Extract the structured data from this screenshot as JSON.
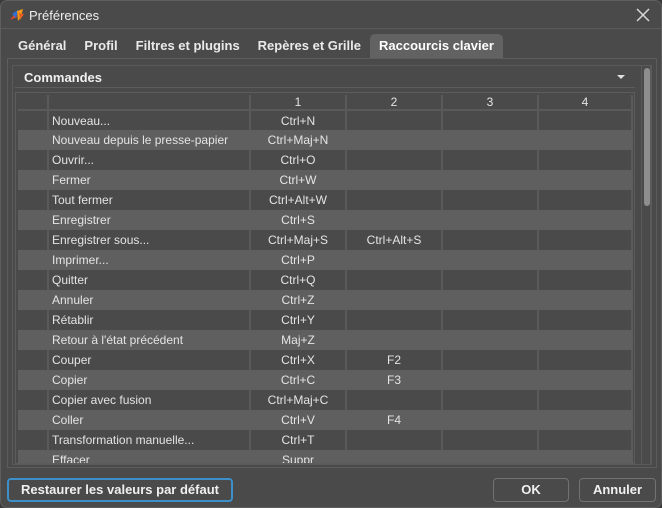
{
  "window": {
    "title": "Préférences",
    "app_icon": "app-logo-icon",
    "close_icon": "close-icon"
  },
  "tabs": [
    {
      "label": "Général",
      "active": false
    },
    {
      "label": "Profil",
      "active": false
    },
    {
      "label": "Filtres et plugins",
      "active": false
    },
    {
      "label": "Repères et Grille",
      "active": false
    },
    {
      "label": "Raccourcis clavier",
      "active": true
    }
  ],
  "section": {
    "title": "Commandes",
    "dropdown_icon": "dropdown-arrow-icon"
  },
  "table": {
    "columns": [
      "",
      "",
      "1",
      "2",
      "3",
      "4"
    ],
    "rows": [
      {
        "command": "Nouveau...",
        "k1": "Ctrl+N",
        "k2": "",
        "k3": "",
        "k4": ""
      },
      {
        "command": "Nouveau depuis le presse-papier",
        "k1": "Ctrl+Maj+N",
        "k2": "",
        "k3": "",
        "k4": ""
      },
      {
        "command": "Ouvrir...",
        "k1": "Ctrl+O",
        "k2": "",
        "k3": "",
        "k4": ""
      },
      {
        "command": "Fermer",
        "k1": "Ctrl+W",
        "k2": "",
        "k3": "",
        "k4": ""
      },
      {
        "command": "Tout fermer",
        "k1": "Ctrl+Alt+W",
        "k2": "",
        "k3": "",
        "k4": ""
      },
      {
        "command": "Enregistrer",
        "k1": "Ctrl+S",
        "k2": "",
        "k3": "",
        "k4": ""
      },
      {
        "command": "Enregistrer sous...",
        "k1": "Ctrl+Maj+S",
        "k2": "Ctrl+Alt+S",
        "k3": "",
        "k4": ""
      },
      {
        "command": "Imprimer...",
        "k1": "Ctrl+P",
        "k2": "",
        "k3": "",
        "k4": ""
      },
      {
        "command": "Quitter",
        "k1": "Ctrl+Q",
        "k2": "",
        "k3": "",
        "k4": ""
      },
      {
        "command": "Annuler",
        "k1": "Ctrl+Z",
        "k2": "",
        "k3": "",
        "k4": ""
      },
      {
        "command": "Rétablir",
        "k1": "Ctrl+Y",
        "k2": "",
        "k3": "",
        "k4": ""
      },
      {
        "command": "Retour à l'état précédent",
        "k1": "Maj+Z",
        "k2": "",
        "k3": "",
        "k4": ""
      },
      {
        "command": "Couper",
        "k1": "Ctrl+X",
        "k2": "F2",
        "k3": "",
        "k4": ""
      },
      {
        "command": "Copier",
        "k1": "Ctrl+C",
        "k2": "F3",
        "k3": "",
        "k4": ""
      },
      {
        "command": "Copier avec fusion",
        "k1": "Ctrl+Maj+C",
        "k2": "",
        "k3": "",
        "k4": ""
      },
      {
        "command": "Coller",
        "k1": "Ctrl+V",
        "k2": "F4",
        "k3": "",
        "k4": ""
      },
      {
        "command": "Transformation manuelle...",
        "k1": "Ctrl+T",
        "k2": "",
        "k3": "",
        "k4": ""
      },
      {
        "command": "Effacer",
        "k1": "Suppr",
        "k2": "",
        "k3": "",
        "k4": ""
      }
    ]
  },
  "buttons": {
    "restore": "Restaurer les valeurs par défaut",
    "ok": "OK",
    "cancel": "Annuler"
  },
  "colors": {
    "focus_accent": "#3d8fc9",
    "background": "#4a4a4a",
    "row_alt": "#5f5f5f",
    "active_tab": "#626262"
  }
}
